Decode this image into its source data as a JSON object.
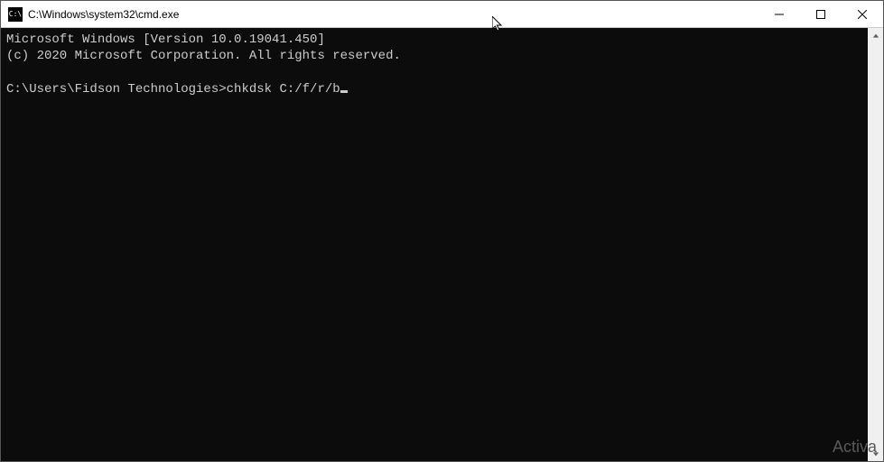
{
  "titlebar": {
    "icon_text": "C:\\",
    "title": "C:\\Windows\\system32\\cmd.exe"
  },
  "terminal": {
    "line1": "Microsoft Windows [Version 10.0.19041.450]",
    "line2": "(c) 2020 Microsoft Corporation. All rights reserved.",
    "blank": "",
    "prompt": "C:\\Users\\Fidson Technologies>",
    "command": "chkdsk C:/f/r/b"
  },
  "watermark": "Activa"
}
